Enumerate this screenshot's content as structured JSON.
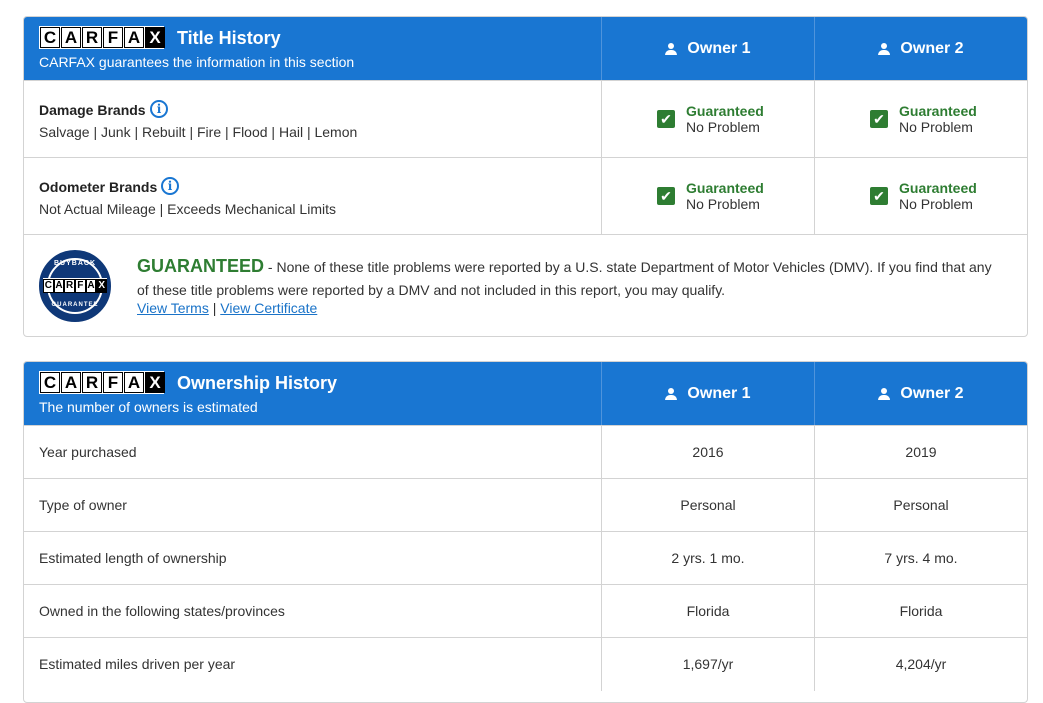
{
  "title_history": {
    "logo_letters": [
      "C",
      "A",
      "R",
      "F",
      "A",
      "X"
    ],
    "title": "Title History",
    "subtitle": "CARFAX guarantees the information in this section",
    "owners": [
      "Owner 1",
      "Owner 2"
    ],
    "rows": [
      {
        "label": "Damage Brands",
        "details": "Salvage | Junk | Rebuilt | Fire | Flood | Hail | Lemon",
        "owner1": {
          "status": "Guaranteed",
          "result": "No Problem"
        },
        "owner2": {
          "status": "Guaranteed",
          "result": "No Problem"
        }
      },
      {
        "label": "Odometer Brands",
        "details": "Not Actual Mileage | Exceeds Mechanical Limits",
        "owner1": {
          "status": "Guaranteed",
          "result": "No Problem"
        },
        "owner2": {
          "status": "Guaranteed",
          "result": "No Problem"
        }
      }
    ],
    "guarantee": {
      "seal_top": "BUYBACK",
      "seal_bottom": "GUARANTEE",
      "headline": "GUARANTEED",
      "text": " - None of these title problems were reported by a U.S. state Department of Motor Vehicles (DMV). If you find that any of these title problems were reported by a DMV and not included in this report, you may qualify.",
      "link_terms": "View Terms",
      "link_sep": " | ",
      "link_certificate": "View Certificate"
    }
  },
  "ownership_history": {
    "title": "Ownership History",
    "subtitle": "The number of owners is estimated",
    "owners": [
      "Owner 1",
      "Owner 2"
    ],
    "rows": [
      {
        "label": "Year purchased",
        "owner1": "2016",
        "owner2": "2019"
      },
      {
        "label": "Type of owner",
        "owner1": "Personal",
        "owner2": "Personal"
      },
      {
        "label": "Estimated length of ownership",
        "owner1": "2 yrs. 1 mo.",
        "owner2": "7 yrs. 4 mo."
      },
      {
        "label": "Owned in the following states/provinces",
        "owner1": "Florida",
        "owner2": "Florida"
      },
      {
        "label": "Estimated miles driven per year",
        "owner1": "1,697/yr",
        "owner2": "4,204/yr"
      }
    ]
  },
  "colors": {
    "header_blue": "#1976d2",
    "guaranteed_green": "#2e7d32",
    "link_blue": "#1a73c8"
  }
}
